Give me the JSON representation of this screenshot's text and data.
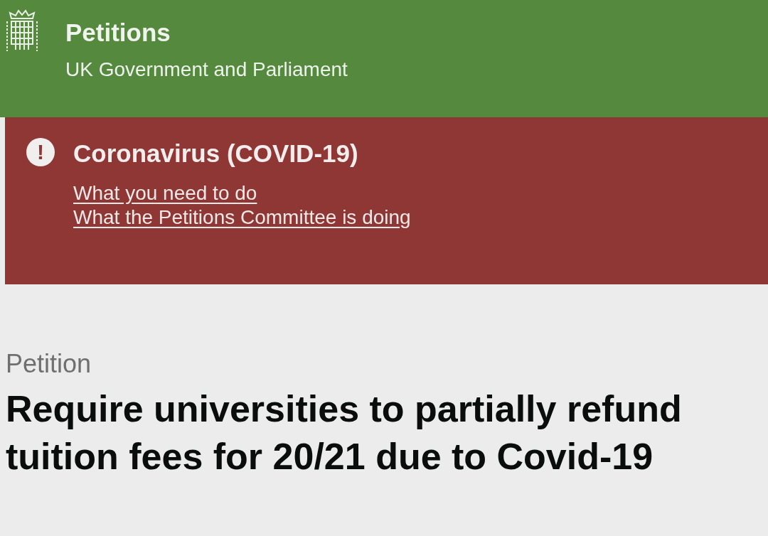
{
  "header": {
    "title": "Petitions",
    "subtitle": "UK Government and Parliament"
  },
  "alert": {
    "icon": "!",
    "heading": "Coronavirus (COVID-19)",
    "links": [
      "What you need to do",
      "What the Petitions Committee is doing"
    ]
  },
  "petition": {
    "label": "Petition",
    "title": "Require universities to partially refund tuition fees for 20/21 due to Covid-19"
  }
}
